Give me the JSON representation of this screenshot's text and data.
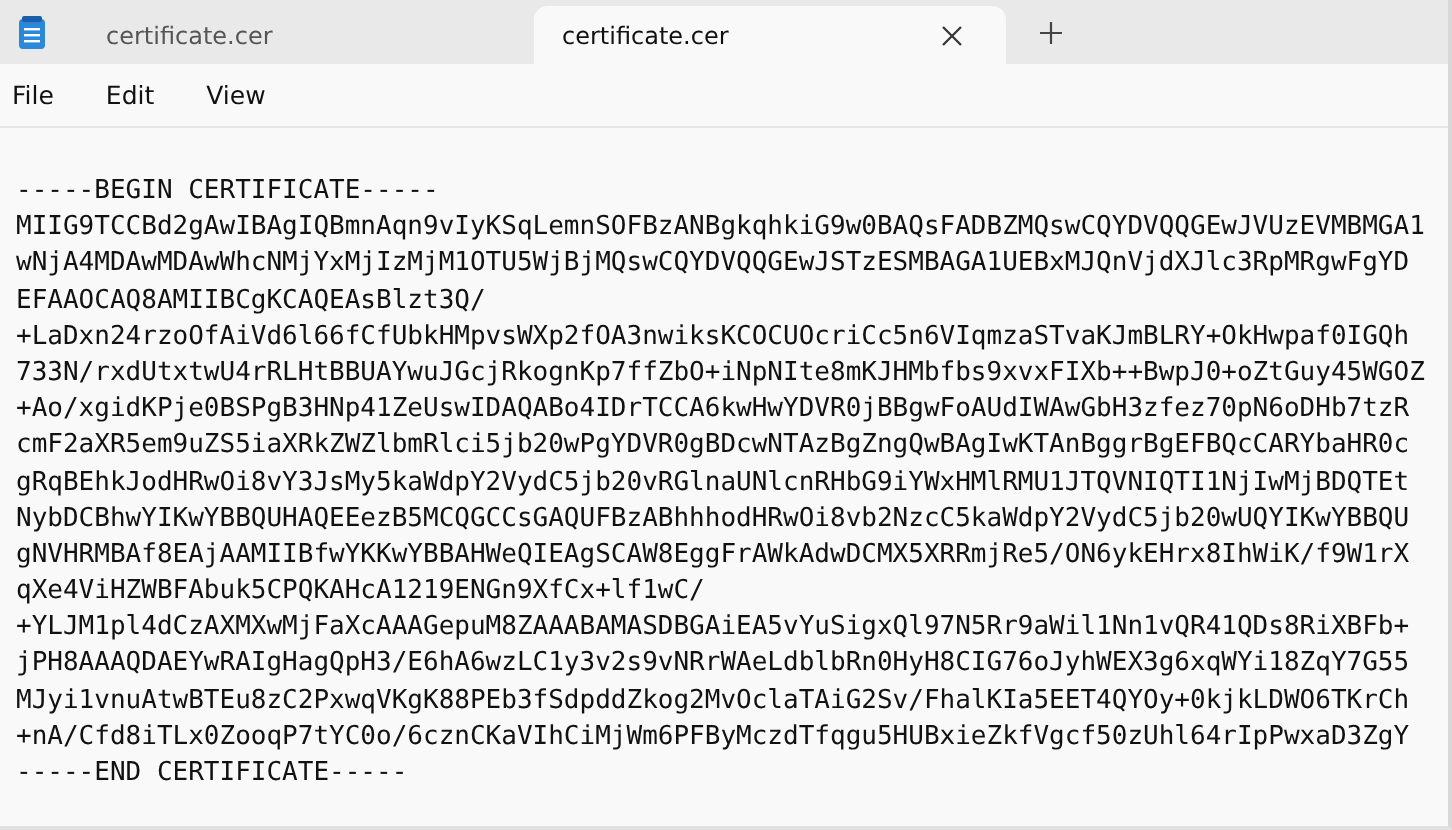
{
  "tabs": [
    {
      "title": "certificate.cer",
      "selected": false
    },
    {
      "title": "certificate.cer",
      "selected": true
    }
  ],
  "menu": [
    "File",
    "Edit",
    "View"
  ],
  "editor": {
    "lines": [
      "-----BEGIN CERTIFICATE-----",
      "MIIG9TCCBd2gAwIBAgIQBmnAqn9vIyKSqLemnSOFBzANBgkqhkiG9w0BAQsFADBZMQswCQYDVQQGEwJVUzEVMBMGA1",
      "wNjA4MDAwMDAwWhcNMjYxMjIzMjM1OTU5WjBjMQswCQYDVQQGEwJSTzESMBAGA1UEBxMJQnVjdXJlc3RpMRgwFgYD",
      "EFAAOCAQ8AMIIBCgKCAQEAsBlzt3Q/",
      "+LaDxn24rzoOfAiVd6l66fCfUbkHMpvsWXp2fOA3nwiksKCOCUOcriCc5n6VIqmzaSTvaKJmBLRY+OkHwpaf0IGQh",
      "733N/rxdUtxtwU4rRLHtBBUAYwuJGcjRkognKp7ffZbO+iNpNIte8mKJHMbfbs9xvxFIXb++BwpJ0+oZtGuy45WGOZ",
      "+Ao/xgidKPje0BSPgB3HNp41ZeUswIDAQABo4IDrTCCA6kwHwYDVR0jBBgwFoAUdIWAwGbH3zfez70pN6oDHb7tzR",
      "cmF2aXR5em9uZS5iaXRkZWZlbmRlci5jb20wPgYDVR0gBDcwNTAzBgZngQwBAgIwKTAnBggrBgEFBQcCARYbaHR0c",
      "gRqBEhkJodHRwOi8vY3JsMy5kaWdpY2VydC5jb20vRGlnaUNlcnRHbG9iYWxHMlRMU1JTQVNIQTI1NjIwMjBDQTEt",
      "NybDCBhwYIKwYBBQUHAQEEezB5MCQGCCsGAQUFBzABhhhodHRwOi8vb2NzcC5kaWdpY2VydC5jb20wUQYIKwYBBQU",
      "gNVHRMBAf8EAjAAMIIBfwYKKwYBBAHWeQIEAgSCAW8EggFrAWkAdwDCMX5XRRmjRe5/ON6ykEHrx8IhWiK/f9W1rX",
      "qXe4ViHZWBFAbuk5CPQKAHcA1219ENGn9XfCx+lf1wC/",
      "+YLJM1pl4dCzAXMXwMjFaXcAAAGepuM8ZAAABAMASDBGAiEA5vYuSigxQl97N5Rr9aWil1Nn1vQR41QDs8RiXBFb+",
      "jPH8AAAQDAEYwRAIgHagQpH3/E6hA6wzLC1y3v2s9vNRrWAeLdblbRn0HyH8CIG76oJyhWEX3g6xqWYi18ZqY7G55",
      "MJyi1vnuAtwBTEu8zC2PxwqVKgK88PEb3fSdpddZkog2MvOclaTAiG2Sv/FhalKIa5EET4QYOy+0kjkLDWO6TKrCh",
      "+nA/Cfd8iTLx0ZooqP7tYC0o/6cznCKaVIhCiMjWm6PFByMczdTfqgu5HUBxieZkfVgcf50zUhl64rIpPwxaD3ZgY",
      "-----END CERTIFICATE-----"
    ]
  }
}
